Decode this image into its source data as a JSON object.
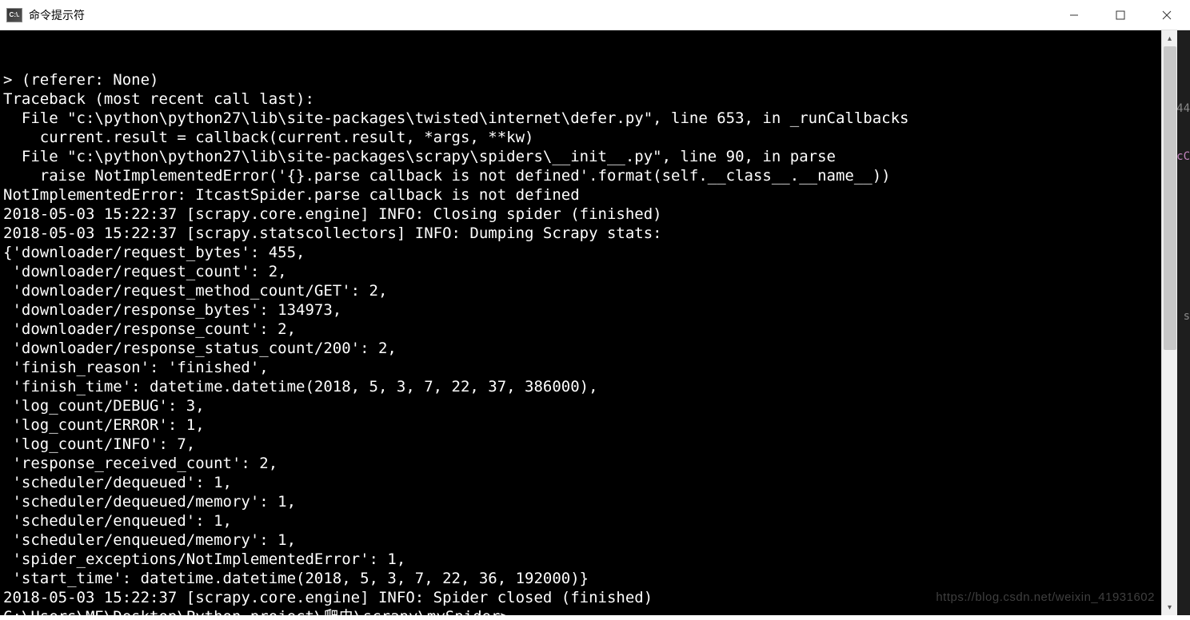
{
  "window": {
    "title": "命令提示符",
    "app_icon_text": "C:\\."
  },
  "terminal": {
    "lines": [
      "> (referer: None)",
      "Traceback (most recent call last):",
      "  File \"c:\\python\\python27\\lib\\site-packages\\twisted\\internet\\defer.py\", line 653, in _runCallbacks",
      "    current.result = callback(current.result, *args, **kw)",
      "  File \"c:\\python\\python27\\lib\\site-packages\\scrapy\\spiders\\__init__.py\", line 90, in parse",
      "    raise NotImplementedError('{}.parse callback is not defined'.format(self.__class__.__name__))",
      "NotImplementedError: ItcastSpider.parse callback is not defined",
      "2018-05-03 15:22:37 [scrapy.core.engine] INFO: Closing spider (finished)",
      "2018-05-03 15:22:37 [scrapy.statscollectors] INFO: Dumping Scrapy stats:",
      "{'downloader/request_bytes': 455,",
      " 'downloader/request_count': 2,",
      " 'downloader/request_method_count/GET': 2,",
      " 'downloader/response_bytes': 134973,",
      " 'downloader/response_count': 2,",
      " 'downloader/response_status_count/200': 2,",
      " 'finish_reason': 'finished',",
      " 'finish_time': datetime.datetime(2018, 5, 3, 7, 22, 37, 386000),",
      " 'log_count/DEBUG': 3,",
      " 'log_count/ERROR': 1,",
      " 'log_count/INFO': 7,",
      " 'response_received_count': 2,",
      " 'scheduler/dequeued': 1,",
      " 'scheduler/dequeued/memory': 1,",
      " 'scheduler/enqueued': 1,",
      " 'scheduler/enqueued/memory': 1,",
      " 'spider_exceptions/NotImplementedError': 1,",
      " 'start_time': datetime.datetime(2018, 5, 3, 7, 22, 36, 192000)}",
      "2018-05-03 15:22:37 [scrapy.core.engine] INFO: Spider closed (finished)",
      "",
      "C:\\Users\\ME\\Desktop\\Python project\\爬虫\\scrapy\\mySpider>"
    ]
  },
  "side_fragments": {
    "f1": "44",
    "f2": "cC",
    "f3": "s"
  },
  "watermark": "https://blog.csdn.net/weixin_41931602"
}
